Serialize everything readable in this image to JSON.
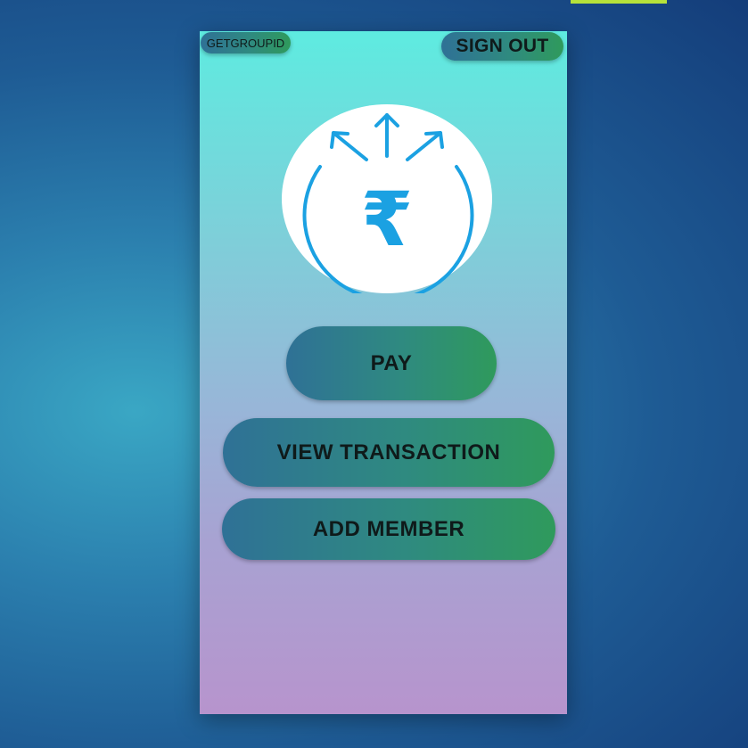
{
  "header": {
    "group_id_label": "GETGROUPID",
    "sign_out_label": "SIGN OUT"
  },
  "logo": {
    "icon": "rupee-send-icon",
    "symbol": "₹",
    "accent_color": "#1ba1e2"
  },
  "actions": {
    "pay_label": "PAY",
    "view_transaction_label": "VIEW TRANSACTION",
    "add_member_label": "ADD MEMBER"
  },
  "colors": {
    "screen_gradient_top": "#5eebe0",
    "screen_gradient_bottom": "#b794cd",
    "button_gradient_start": "#2f7196",
    "button_gradient_end": "#2f9a5c"
  }
}
